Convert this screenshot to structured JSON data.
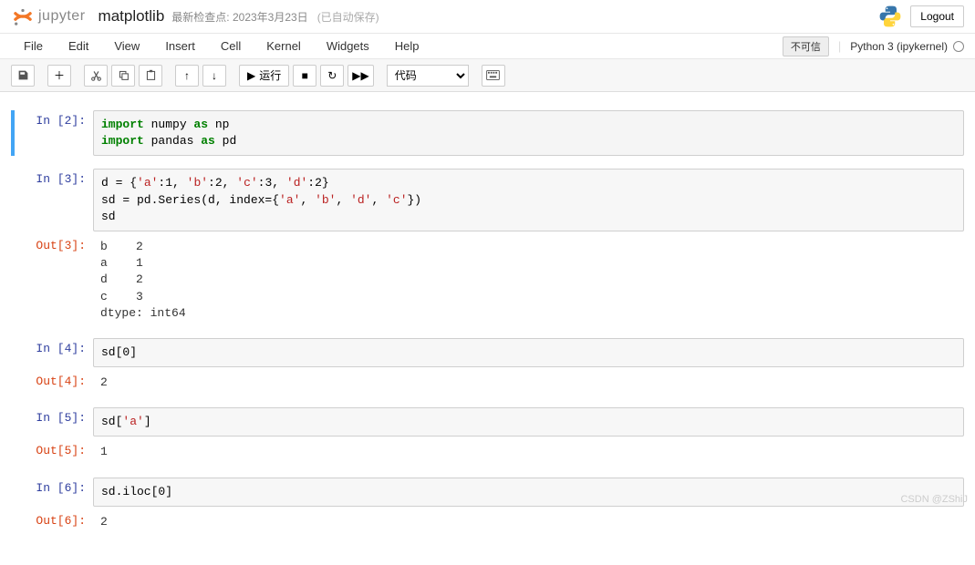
{
  "header": {
    "logo_text": "jupyter",
    "notebook_name": "matplotlib",
    "checkpoint": "最新检查点: 2023年3月23日",
    "autosave": "(已自动保存)",
    "logout": "Logout"
  },
  "menubar": {
    "items": [
      "File",
      "Edit",
      "View",
      "Insert",
      "Cell",
      "Kernel",
      "Widgets",
      "Help"
    ],
    "trust": "不可信",
    "kernel": "Python 3 (ipykernel)"
  },
  "toolbar": {
    "save_title": "保存",
    "add_title": "添加",
    "cut_title": "剪切",
    "copy_title": "复制",
    "paste_title": "粘贴",
    "up_title": "上移",
    "down_title": "下移",
    "run_label": "运行",
    "stop_title": "中断",
    "restart_title": "重启",
    "ff_title": "重启并运行",
    "celltype_selected": "代码",
    "cmd_title": "命令面板"
  },
  "cells": [
    {
      "in_prompt": "In  [2]:",
      "code_tokens": [
        {
          "t": "import",
          "c": "kw"
        },
        {
          "t": " numpy ",
          "c": "nm"
        },
        {
          "t": "as",
          "c": "kw"
        },
        {
          "t": " np\n",
          "c": "nm"
        },
        {
          "t": "import",
          "c": "kw"
        },
        {
          "t": " pandas ",
          "c": "nm"
        },
        {
          "t": "as",
          "c": "kw"
        },
        {
          "t": " pd",
          "c": "nm"
        }
      ],
      "selected": true
    },
    {
      "in_prompt": "In  [3]:",
      "code_tokens": [
        {
          "t": "d = {",
          "c": "nm"
        },
        {
          "t": "'a'",
          "c": "str"
        },
        {
          "t": ":1, ",
          "c": "nm"
        },
        {
          "t": "'b'",
          "c": "str"
        },
        {
          "t": ":2, ",
          "c": "nm"
        },
        {
          "t": "'c'",
          "c": "str"
        },
        {
          "t": ":3, ",
          "c": "nm"
        },
        {
          "t": "'d'",
          "c": "str"
        },
        {
          "t": ":2}\n",
          "c": "nm"
        },
        {
          "t": "sd = pd.Series(d, index={",
          "c": "nm"
        },
        {
          "t": "'a'",
          "c": "str"
        },
        {
          "t": ", ",
          "c": "nm"
        },
        {
          "t": "'b'",
          "c": "str"
        },
        {
          "t": ", ",
          "c": "nm"
        },
        {
          "t": "'d'",
          "c": "str"
        },
        {
          "t": ", ",
          "c": "nm"
        },
        {
          "t": "'c'",
          "c": "str"
        },
        {
          "t": "})\n",
          "c": "nm"
        },
        {
          "t": "sd",
          "c": "nm"
        }
      ],
      "out_prompt": "Out[3]:",
      "output": "b    2\na    1\nd    2\nc    3\ndtype: int64"
    },
    {
      "in_prompt": "In  [4]:",
      "code_tokens": [
        {
          "t": "sd[0]",
          "c": "nm"
        }
      ],
      "out_prompt": "Out[4]:",
      "output": "2"
    },
    {
      "in_prompt": "In  [5]:",
      "code_tokens": [
        {
          "t": "sd[",
          "c": "nm"
        },
        {
          "t": "'a'",
          "c": "str"
        },
        {
          "t": "]",
          "c": "nm"
        }
      ],
      "out_prompt": "Out[5]:",
      "output": "1"
    },
    {
      "in_prompt": "In  [6]:",
      "code_tokens": [
        {
          "t": "sd.iloc[0]",
          "c": "nm"
        }
      ],
      "out_prompt": "Out[6]:",
      "output": "2"
    }
  ],
  "watermark": "CSDN @ZShiJ"
}
